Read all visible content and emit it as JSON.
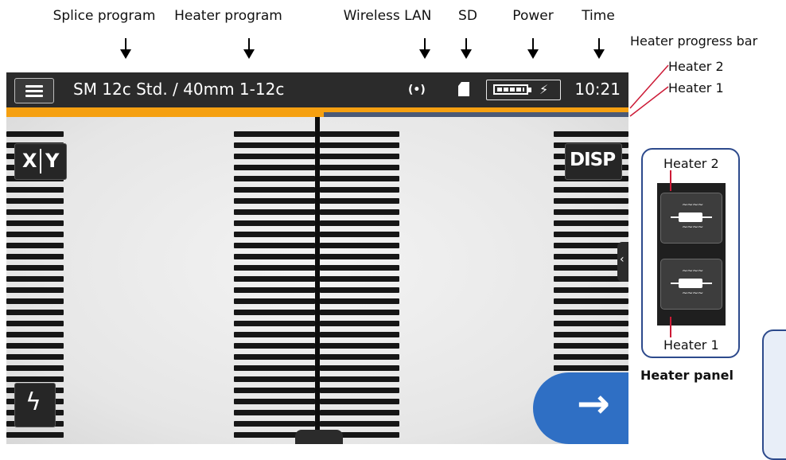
{
  "callouts": {
    "splice_program": "Splice program",
    "heater_program": "Heater program",
    "wireless_lan": "Wireless LAN",
    "sd": "SD",
    "power": "Power",
    "time": "Time",
    "heater_progress_bar": "Heater progress bar",
    "heater_2": "Heater 2",
    "heater_1": "Heater 1"
  },
  "titlebar": {
    "program": "SM 12c Std. / 40mm 1-12c",
    "wifi_symbol": "(•)",
    "time": "10:21",
    "battery_level": 1.0,
    "charging": true
  },
  "heater_progress": {
    "heater_2_fraction": 1.0,
    "heater_1_fraction": 0.51,
    "color_active": "#f5a011",
    "color_track": "#4a5a78"
  },
  "buttons": {
    "xy_x": "X",
    "xy_y": "Y",
    "disp": "DISP",
    "arc_icon": "lightning-bolt-icon",
    "next_icon": "right-arrow-icon",
    "menu_icon": "hamburger-menu-icon"
  },
  "heater_panel": {
    "title": "Heater panel",
    "label_top": "Heater 2",
    "label_bottom": "Heater 1"
  },
  "colors": {
    "accent_blue": "#2f6fc4",
    "frame_blue": "#2d4a8c",
    "leader_red": "#cc1a36"
  }
}
